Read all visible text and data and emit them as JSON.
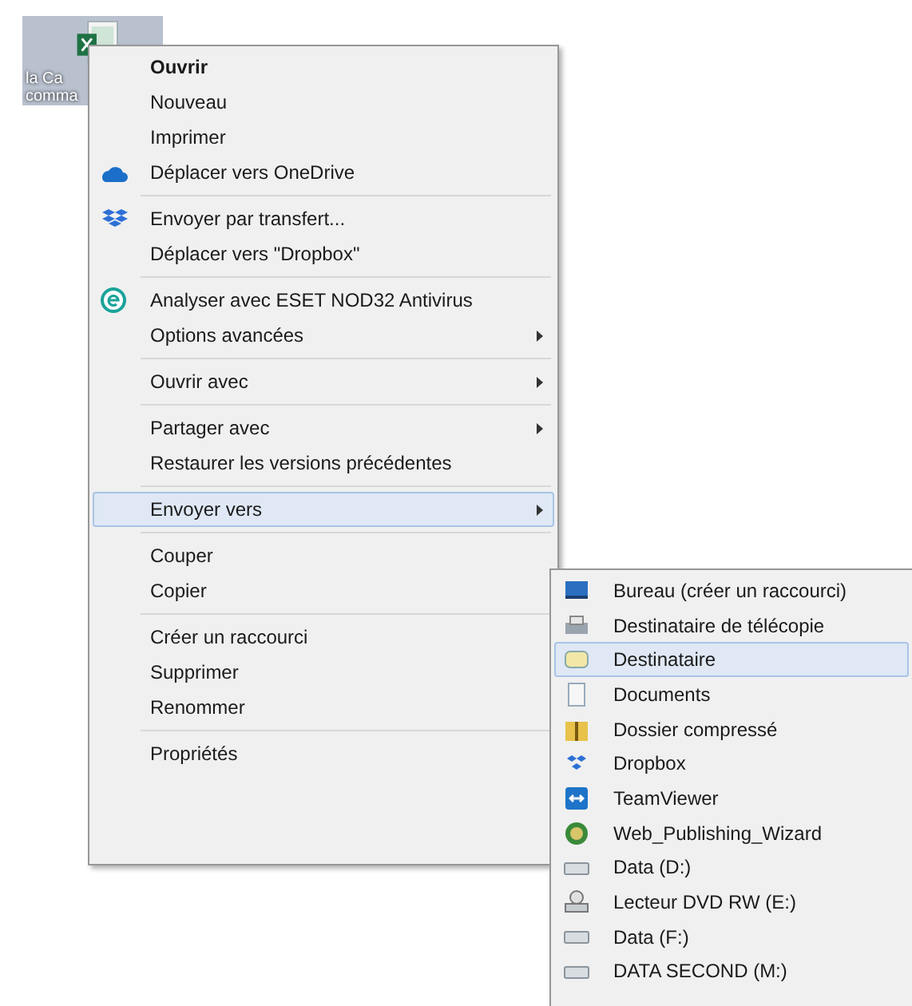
{
  "desktop_icon": {
    "label_lines": [
      "la Ca",
      "comma"
    ],
    "selected": true
  },
  "context_menu": {
    "items": [
      {
        "kind": "item",
        "label": "Ouvrir",
        "bold": true,
        "submenu": false,
        "selected": false
      },
      {
        "kind": "item",
        "label": "Nouveau",
        "bold": false,
        "submenu": false,
        "selected": false
      },
      {
        "kind": "item",
        "label": "Imprimer",
        "bold": false,
        "submenu": false,
        "selected": false
      },
      {
        "kind": "item",
        "label": "Déplacer vers OneDrive",
        "bold": false,
        "submenu": false,
        "selected": false
      },
      {
        "kind": "separator"
      },
      {
        "kind": "item",
        "label": "Envoyer par transfert...",
        "bold": false,
        "submenu": false,
        "selected": false
      },
      {
        "kind": "item",
        "label": "Déplacer vers \"Dropbox\"",
        "bold": false,
        "submenu": false,
        "selected": false
      },
      {
        "kind": "separator"
      },
      {
        "kind": "item",
        "label": "Analyser avec ESET NOD32 Antivirus",
        "bold": false,
        "submenu": false,
        "selected": false
      },
      {
        "kind": "item",
        "label": "Options avancées",
        "bold": false,
        "submenu": true,
        "selected": false
      },
      {
        "kind": "separator"
      },
      {
        "kind": "item",
        "label": "Ouvrir avec",
        "bold": false,
        "submenu": true,
        "selected": false
      },
      {
        "kind": "separator"
      },
      {
        "kind": "item",
        "label": "Partager avec",
        "bold": false,
        "submenu": true,
        "selected": false
      },
      {
        "kind": "item",
        "label": "Restaurer les versions précédentes",
        "bold": false,
        "submenu": false,
        "selected": false
      },
      {
        "kind": "separator"
      },
      {
        "kind": "item",
        "label": "Envoyer vers",
        "bold": false,
        "submenu": true,
        "selected": true
      },
      {
        "kind": "separator"
      },
      {
        "kind": "item",
        "label": "Couper",
        "bold": false,
        "submenu": false,
        "selected": false
      },
      {
        "kind": "item",
        "label": "Copier",
        "bold": false,
        "submenu": false,
        "selected": false
      },
      {
        "kind": "separator"
      },
      {
        "kind": "item",
        "label": "Créer un raccourci",
        "bold": false,
        "submenu": false,
        "selected": false
      },
      {
        "kind": "item",
        "label": "Supprimer",
        "bold": false,
        "submenu": false,
        "selected": false
      },
      {
        "kind": "item",
        "label": "Renommer",
        "bold": false,
        "submenu": false,
        "selected": false
      },
      {
        "kind": "separator"
      },
      {
        "kind": "item",
        "label": "Propriétés",
        "bold": false,
        "submenu": false,
        "selected": false
      }
    ]
  },
  "send_to_submenu": {
    "items": [
      {
        "label": "Bureau (créer un raccourci)",
        "selected": false
      },
      {
        "label": "Destinataire de télécopie",
        "selected": false
      },
      {
        "label": "Destinataire",
        "selected": true
      },
      {
        "label": "Documents",
        "selected": false
      },
      {
        "label": "Dossier compressé",
        "selected": false
      },
      {
        "label": "Dropbox",
        "selected": false
      },
      {
        "label": "TeamViewer",
        "selected": false
      },
      {
        "label": "Web_Publishing_Wizard",
        "selected": false
      },
      {
        "label": "Data (D:)",
        "selected": false
      },
      {
        "label": "Lecteur DVD RW (E:)",
        "selected": false
      },
      {
        "label": "Data (F:)",
        "selected": false
      },
      {
        "label": "DATA SECOND (M:)",
        "selected": false
      }
    ]
  }
}
